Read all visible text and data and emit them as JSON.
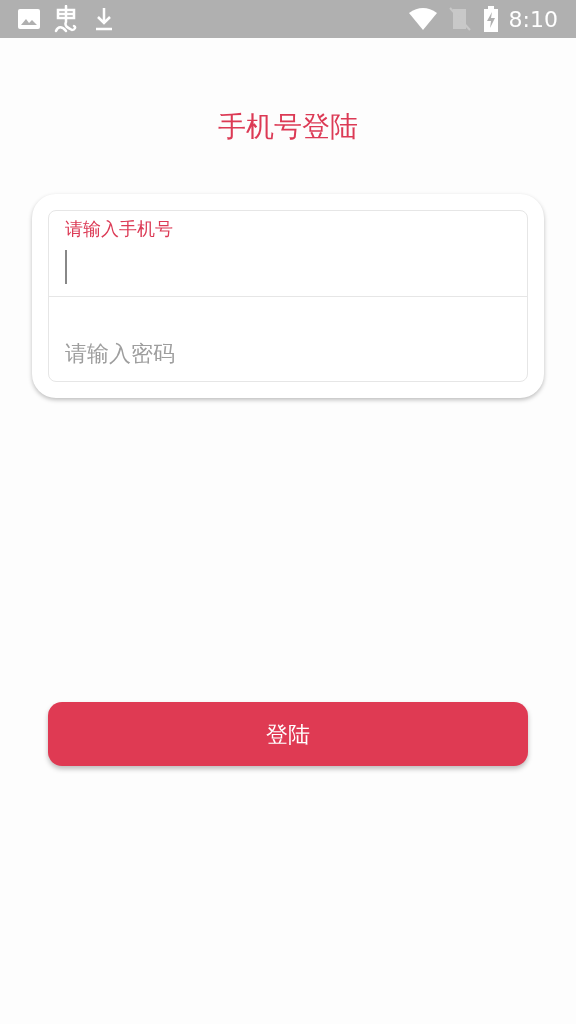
{
  "status_bar": {
    "time": "8:10"
  },
  "title": "手机号登陆",
  "fields": [
    {
      "placeholder": "请输入手机号",
      "focused": true
    },
    {
      "placeholder": "请输入密码",
      "focused": false
    }
  ],
  "login_button": "登陆"
}
